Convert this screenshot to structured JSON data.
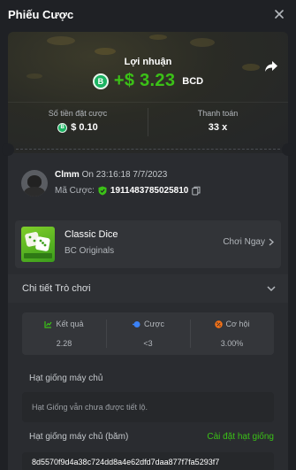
{
  "header": {
    "title": "Phiếu Cược"
  },
  "summary": {
    "profit_label": "Lợi nhuận",
    "profit_amount": "+$ 3.23",
    "currency": "BCD",
    "bet_amount_label": "Số tiền đặt cược",
    "bet_amount": "$ 0.10",
    "payout_label": "Thanh toán",
    "payout": "33 x"
  },
  "user": {
    "name": "Clmm",
    "on_text": " On 23:16:18 7/7/2023",
    "bet_id_label": "Mã Cược:",
    "bet_id": "1911483785025810"
  },
  "game": {
    "name": "Classic Dice",
    "provider": "BC Originals",
    "play_label": "Chơi Ngay"
  },
  "details": {
    "title": "Chi tiết Trò chơi",
    "result_label": "Kết quả",
    "result_value": "2.28",
    "bet_label": "Cược",
    "bet_value": "<3",
    "chance_label": "Cơ hội",
    "chance_value": "3.00%"
  },
  "seeds": {
    "server_seed_label": "Hạt giống máy chủ",
    "server_seed_placeholder": "Hạt Giống vẫn chưa được tiết lộ.",
    "hashed_label": "Hạt giống máy chủ (băm)",
    "settings_link": "Cài đặt hạt giống",
    "hashed_value": "8d5570f9d4a38c724dd8a4e62dfd7daa877f7fa5293f7"
  },
  "colors": {
    "accent_green": "#3bc117",
    "coin_green": "#1cb362",
    "background": "#1f2125"
  }
}
